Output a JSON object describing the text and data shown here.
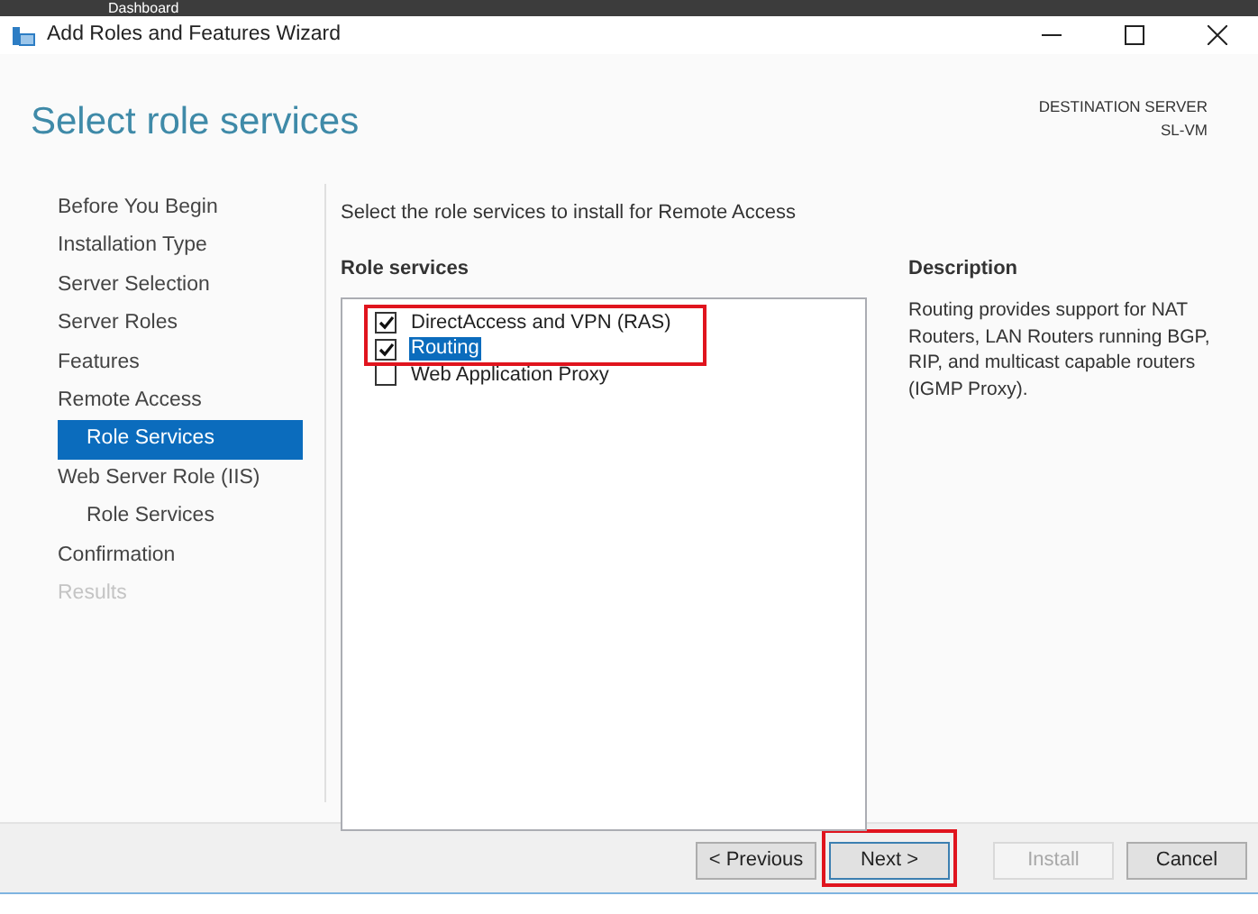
{
  "background_window": {
    "title": "Dashboard"
  },
  "window": {
    "title": "Add Roles and Features Wizard"
  },
  "header": {
    "title": "Select role services",
    "destination_label": "DESTINATION SERVER",
    "destination_server": "SL-VM"
  },
  "steps": [
    {
      "label": "Before You Begin",
      "selected": false,
      "disabled": false
    },
    {
      "label": "Installation Type",
      "selected": false,
      "disabled": false
    },
    {
      "label": "Server Selection",
      "selected": false,
      "disabled": false
    },
    {
      "label": "Server Roles",
      "selected": false,
      "disabled": false
    },
    {
      "label": "Features",
      "selected": false,
      "disabled": false
    },
    {
      "label": "Remote Access",
      "selected": false,
      "disabled": false,
      "children": [
        {
          "label": "Role Services",
          "selected": true
        }
      ]
    },
    {
      "label": "Web Server Role (IIS)",
      "selected": false,
      "disabled": false,
      "children": [
        {
          "label": "Role Services",
          "selected": false
        }
      ]
    },
    {
      "label": "Confirmation",
      "selected": false,
      "disabled": false
    },
    {
      "label": "Results",
      "selected": false,
      "disabled": true
    }
  ],
  "instruction": "Select the role services to install for Remote Access",
  "role_services": {
    "heading": "Role services",
    "items": [
      {
        "label": "DirectAccess and VPN (RAS)",
        "checked": true,
        "selected": false,
        "highlighted": true
      },
      {
        "label": "Routing",
        "checked": true,
        "selected": true,
        "highlighted": true
      },
      {
        "label": "Web Application Proxy",
        "checked": false,
        "selected": false,
        "highlighted": false
      }
    ]
  },
  "description": {
    "heading": "Description",
    "text": "Routing provides support for NAT Routers, LAN Routers running BGP, RIP, and multicast capable routers (IGMP Proxy)."
  },
  "buttons": [
    {
      "label": "< Previous",
      "disabled": false,
      "focused": false,
      "highlighted": false
    },
    {
      "label": "Next >",
      "disabled": false,
      "focused": true,
      "highlighted": true
    },
    {
      "label": "Install",
      "disabled": true,
      "focused": false,
      "highlighted": false
    },
    {
      "label": "Cancel",
      "disabled": false,
      "focused": false,
      "highlighted": false
    }
  ]
}
